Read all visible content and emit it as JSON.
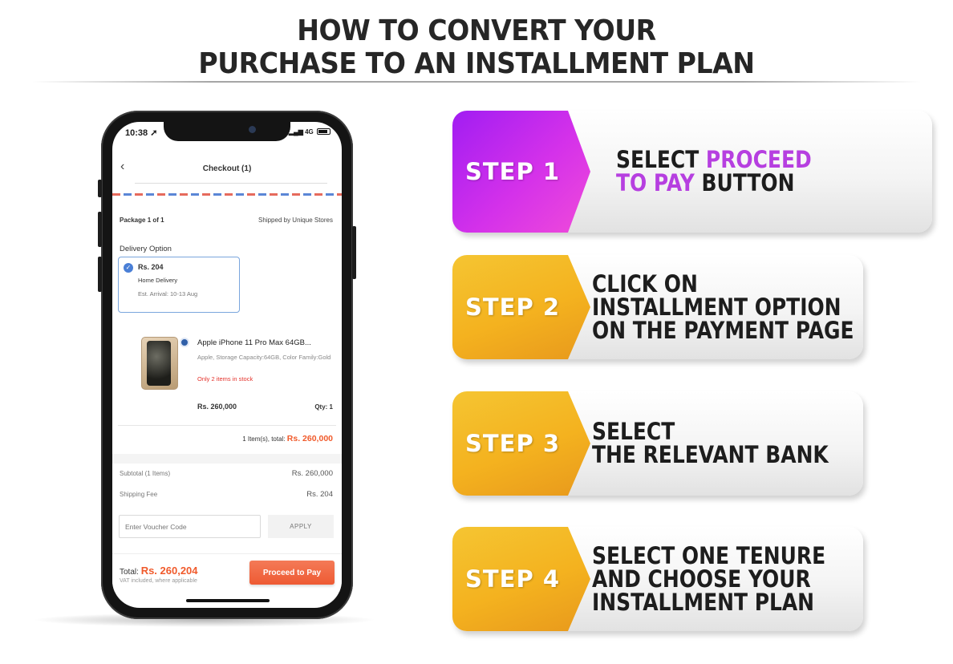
{
  "title": {
    "line1": "HOW TO CONVERT YOUR",
    "line2": "PURCHASE TO AN INSTALLMENT PLAN"
  },
  "phone": {
    "status": {
      "time": "10:38",
      "network": "4G"
    },
    "nav": {
      "title": "Checkout (1)"
    },
    "package": {
      "label": "Package  1 of 1",
      "shipped_by": "Shipped by Unique Stores"
    },
    "delivery": {
      "section_label": "Delivery Option",
      "price": "Rs. 204",
      "type": "Home Delivery",
      "eta": "Est. Arrival: 10-13 Aug"
    },
    "product": {
      "name": "Apple iPhone 11 Pro Max 64GB...",
      "spec": "Apple, Storage Capacity:64GB, Color Family:Gold",
      "stock": "Only 2 items in stock",
      "price": "Rs. 260,000",
      "qty": "Qty:  1"
    },
    "items_total": {
      "label": "1 Item(s), total:",
      "value": "Rs. 260,000"
    },
    "summary": {
      "subtotal_label": "Subtotal (1 Items)",
      "subtotal_value": "Rs. 260,000",
      "fee_label": "Shipping Fee",
      "fee_value": "Rs. 204"
    },
    "voucher": {
      "placeholder": "Enter Voucher Code",
      "apply": "APPLY"
    },
    "footer": {
      "total_label": "Total:",
      "total_value": "Rs. 260,204",
      "vat": "VAT included, where applicable",
      "button": "Proceed to Pay"
    }
  },
  "steps": [
    {
      "label": "STEP 1",
      "lines": [
        [
          "SELECT ",
          "PROCEED"
        ],
        [
          "TO PAY",
          " BUTTON"
        ]
      ]
    },
    {
      "label": "STEP 2",
      "lines": [
        "CLICK ON",
        "INSTALLMENT OPTION",
        "ON THE PAYMENT PAGE"
      ]
    },
    {
      "label": "STEP 3",
      "lines": [
        "SELECT",
        "THE RELEVANT BANK"
      ]
    },
    {
      "label": "STEP 4",
      "lines": [
        "SELECT ONE TENURE",
        "AND CHOOSE YOUR",
        "INSTALLMENT PLAN"
      ]
    }
  ],
  "colors": {
    "step1": "#c62ff0",
    "highlight": "#b63fe0",
    "gold": "#f4b21f",
    "price_orange": "#f05a2b"
  }
}
